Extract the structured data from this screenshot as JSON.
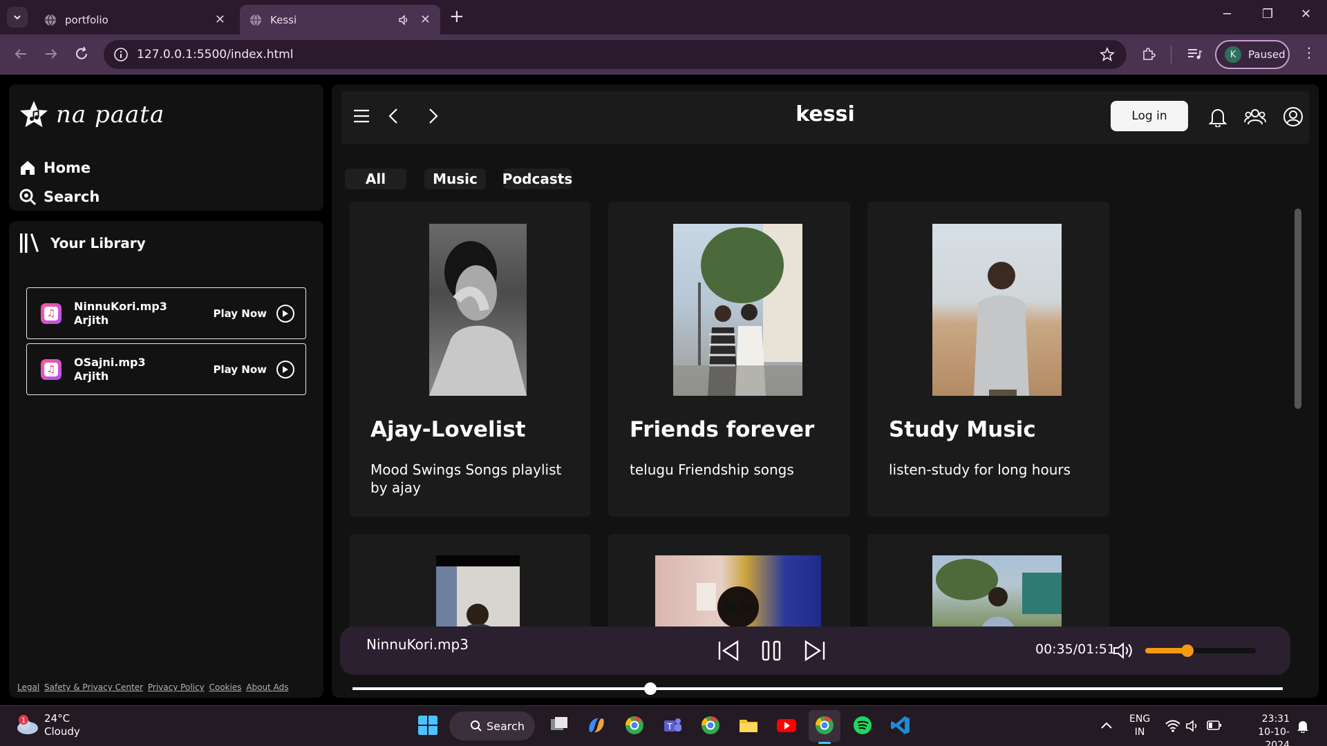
{
  "browser": {
    "tabs": [
      {
        "title": "portfolio",
        "active": false
      },
      {
        "title": "Kessi",
        "active": true
      }
    ],
    "url": "127.0.0.1:5500/index.html",
    "profile": {
      "initial": "K",
      "status": "Paused"
    }
  },
  "sidebar": {
    "logo_text": "na paata",
    "nav": [
      {
        "label": "Home"
      },
      {
        "label": "Search"
      }
    ],
    "library_title": "Your Library",
    "songs": [
      {
        "file": "NinnuKori.mp3",
        "artist": "Arjith",
        "action": "Play Now"
      },
      {
        "file": "OSajni.mp3",
        "artist": "Arjith",
        "action": "Play Now"
      }
    ],
    "footer_links": [
      "Legal",
      "Safety & Privacy Center",
      "Privacy Policy",
      "Cookies",
      "About Ads"
    ]
  },
  "main": {
    "brand": "kessi",
    "login_label": "Log in",
    "filters": [
      "All",
      "Music",
      "Podcasts"
    ],
    "cards": [
      {
        "title": "Ajay-Lovelist",
        "description": "Mood Swings Songs playlist by ajay"
      },
      {
        "title": "Friends forever",
        "description": "telugu Friendship songs"
      },
      {
        "title": "Study Music",
        "description": "listen-study for long hours"
      }
    ]
  },
  "player": {
    "track": "NinnuKori.mp3",
    "time": "00:35/01:51",
    "progress_fraction": 0.32,
    "volume_fraction": 0.38
  },
  "taskbar": {
    "weather": {
      "temp": "24°C",
      "condition": "Cloudy",
      "badge": "1"
    },
    "search_label": "Search",
    "lang": {
      "line1": "ENG",
      "line2": "IN"
    },
    "clock": {
      "time": "23:31",
      "date": "10-10-2024"
    }
  }
}
